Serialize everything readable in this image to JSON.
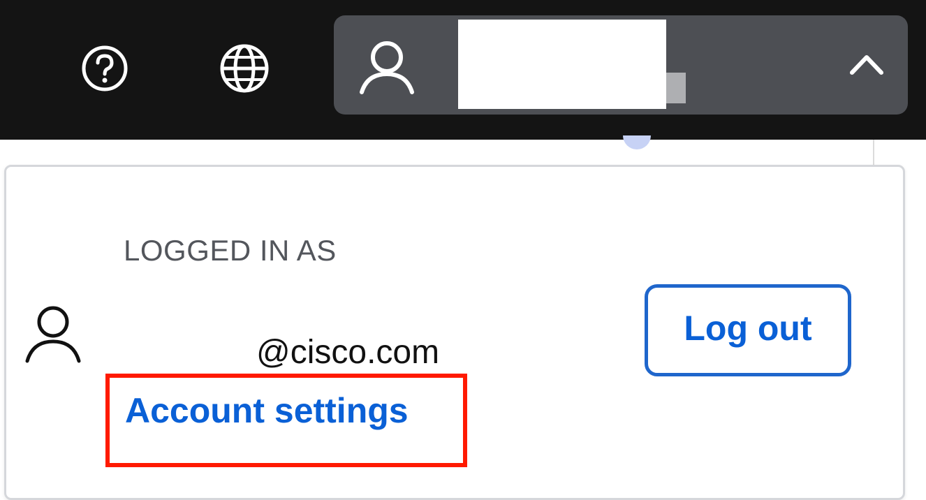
{
  "header": {
    "help_icon": "question-circle-icon",
    "language_icon": "globe-icon",
    "user_menu": {
      "user_icon": "person-icon",
      "username": "",
      "toggle_icon": "chevron-up-icon"
    }
  },
  "account_dropdown": {
    "logged_in_label": "LOGGED IN AS",
    "user_icon": "person-icon",
    "email": "@cisco.com",
    "account_settings_label": "Account settings",
    "logout_label": "Log out"
  },
  "colors": {
    "topbar_background": "#141414",
    "user_menu_background": "#4d4f54",
    "link_blue": "#0a60d6",
    "highlight_red": "#ff1a00"
  }
}
